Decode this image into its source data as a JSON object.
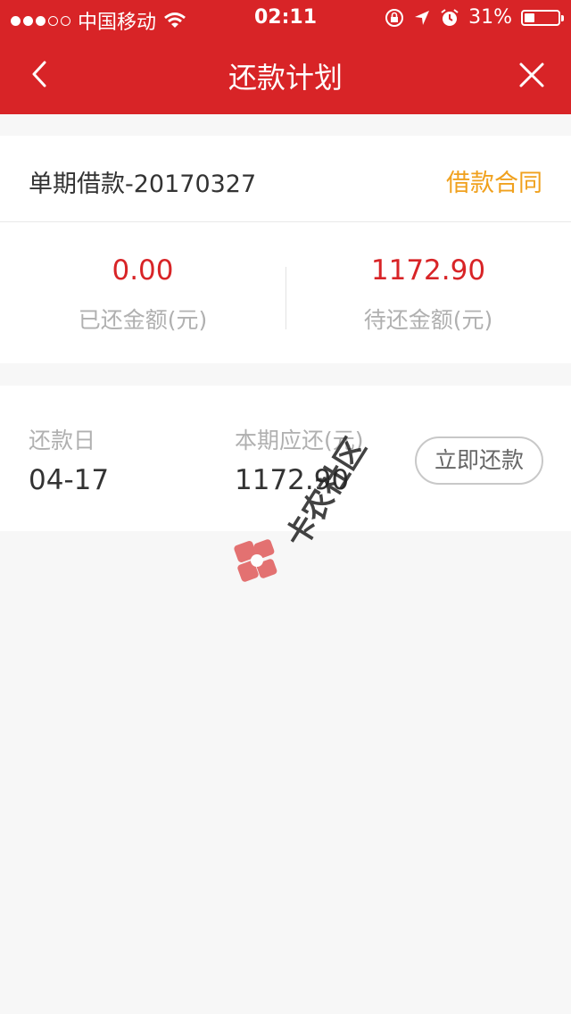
{
  "status_bar": {
    "carrier": "中国移动",
    "time": "02:11",
    "battery": "31%",
    "battery_level": 0.31,
    "icons": [
      "signal-dots-icon",
      "wifi-icon",
      "rotation-lock-icon",
      "location-icon",
      "alarm-icon",
      "battery-icon"
    ]
  },
  "nav": {
    "title": "还款计划",
    "icons": [
      "back-icon",
      "close-icon"
    ]
  },
  "loan": {
    "title": "单期借款-20170327",
    "contract_link": "借款合同"
  },
  "summary": {
    "repaid_amount": "0.00",
    "repaid_label": "已还金额(元)",
    "pending_amount": "1172.90",
    "pending_label": "待还金额(元)"
  },
  "schedule": {
    "date_label": "还款日",
    "date_value": "04-17",
    "amount_label": "本期应还(元)",
    "amount_value": "1172.90",
    "repay_button": "立即还款"
  },
  "watermark": {
    "text": "卡农社区"
  },
  "colors": {
    "brand_red": "#d82427",
    "link_orange": "#f0a11e",
    "muted_text": "#b0b0b0",
    "background": "#f7f7f7"
  }
}
